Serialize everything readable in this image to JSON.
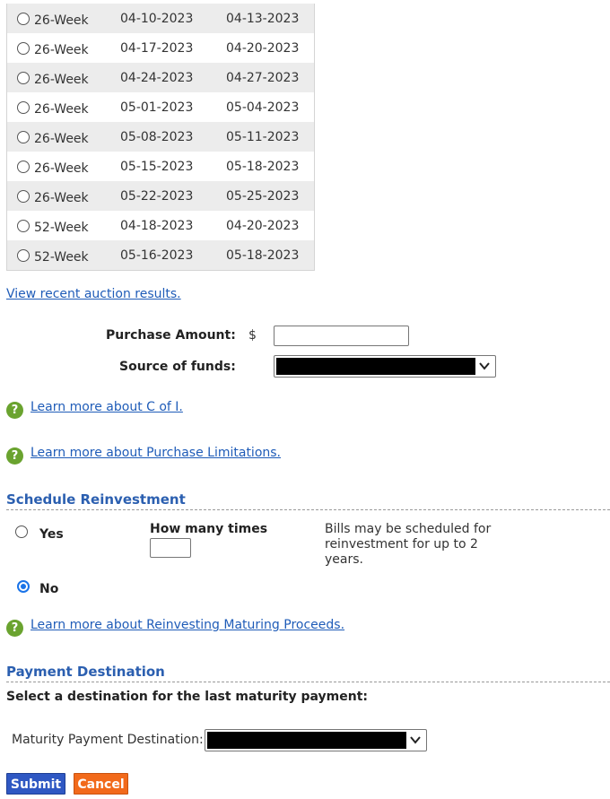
{
  "auctions": [
    {
      "term": "26-Week",
      "auction_date": "04-10-2023",
      "issue_date": "04-13-2023",
      "selected": false
    },
    {
      "term": "26-Week",
      "auction_date": "04-17-2023",
      "issue_date": "04-20-2023",
      "selected": false
    },
    {
      "term": "26-Week",
      "auction_date": "04-24-2023",
      "issue_date": "04-27-2023",
      "selected": false
    },
    {
      "term": "26-Week",
      "auction_date": "05-01-2023",
      "issue_date": "05-04-2023",
      "selected": false
    },
    {
      "term": "26-Week",
      "auction_date": "05-08-2023",
      "issue_date": "05-11-2023",
      "selected": false
    },
    {
      "term": "26-Week",
      "auction_date": "05-15-2023",
      "issue_date": "05-18-2023",
      "selected": false
    },
    {
      "term": "26-Week",
      "auction_date": "05-22-2023",
      "issue_date": "05-25-2023",
      "selected": false
    },
    {
      "term": "52-Week",
      "auction_date": "04-18-2023",
      "issue_date": "04-20-2023",
      "selected": false
    },
    {
      "term": "52-Week",
      "auction_date": "05-16-2023",
      "issue_date": "05-18-2023",
      "selected": false
    }
  ],
  "links": {
    "recent_results": "View recent auction results.",
    "coi": "Learn more about C of I.",
    "purchase_limits": "Learn more about Purchase Limitations.",
    "reinvesting": "Learn more about Reinvesting Maturing Proceeds."
  },
  "purchase": {
    "amount_label": "Purchase Amount:",
    "currency_symbol": "$",
    "amount_value": "",
    "source_label": "Source of funds:"
  },
  "help_icon_glyph": "?",
  "reinvestment": {
    "title": "Schedule Reinvestment",
    "yes_label": "Yes",
    "no_label": "No",
    "selected": "No",
    "times_label": "How many times",
    "times_value": "",
    "note": "Bills may be scheduled for reinvestment for up to 2 years."
  },
  "payment": {
    "title": "Payment Destination",
    "instruction": "Select a destination for the last maturity payment:",
    "destination_label": "Maturity Payment Destination:"
  },
  "buttons": {
    "submit": "Submit",
    "cancel": "Cancel"
  },
  "colors": {
    "link": "#1f5cb8",
    "section_title": "#2b5fb0",
    "help_icon": "#6aa32f",
    "submit": "#2f58c3",
    "cancel": "#f26a1b",
    "radio_selected": "#1a73e8"
  }
}
